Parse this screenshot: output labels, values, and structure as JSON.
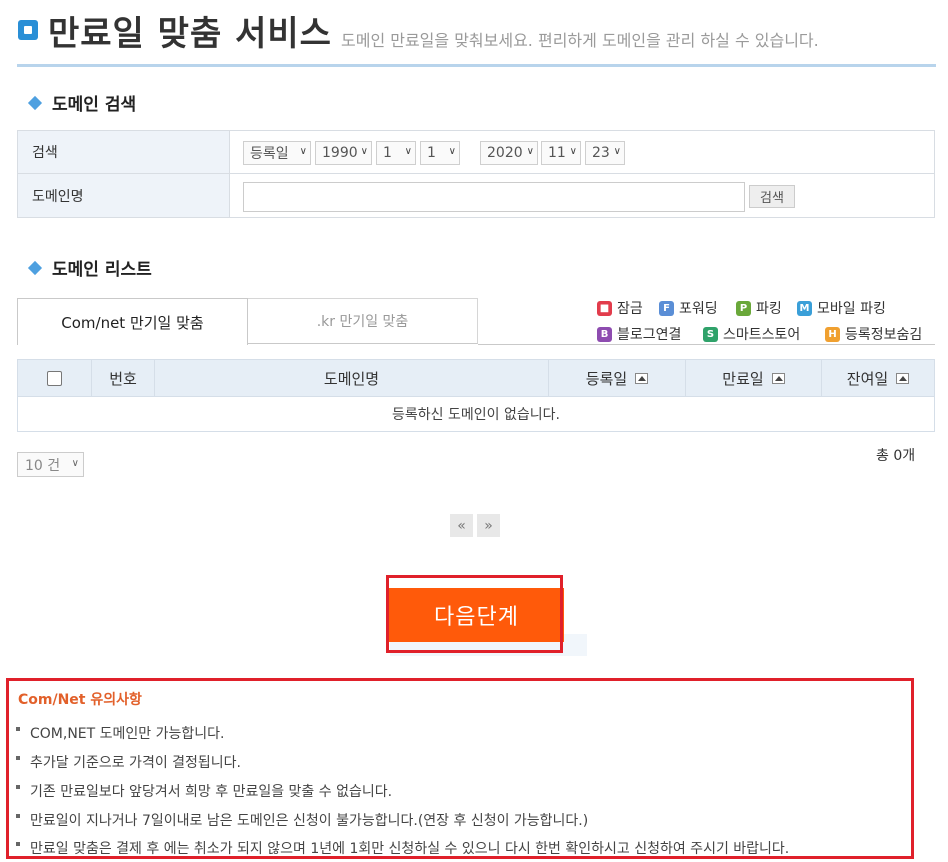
{
  "header": {
    "title": "만료일 맞춤 서비스",
    "subtitle": "도메인 만료일을 맞춰보세요. 편리하게 도메인을 관리 하실 수 있습니다."
  },
  "search_section": {
    "heading": "도메인 검색",
    "row_search_label": "검색",
    "date_type": "등록일",
    "from_year": "1990",
    "from_month": "1",
    "from_day": "1",
    "tilde": "~",
    "to_year": "2020",
    "to_month": "11",
    "to_day": "23",
    "row_domain_label": "도메인명",
    "domain_value": "",
    "search_button": "검색"
  },
  "list_section": {
    "heading": "도메인 리스트",
    "tabs": [
      {
        "label": "Com/net 만기일 맞춤",
        "active": true
      },
      {
        "label": ".kr 만기일 맞춤",
        "active": false
      }
    ],
    "legend": [
      {
        "icon": "lock-icon",
        "glyph": "🔒",
        "label": "잠금",
        "color": "#e23c4c"
      },
      {
        "icon": "forwarding-icon",
        "glyph": "F",
        "label": "포워딩",
        "color": "#5a8ed6"
      },
      {
        "icon": "parking-icon",
        "glyph": "P",
        "label": "파킹",
        "color": "#6aa83a"
      },
      {
        "icon": "mobile-parking-icon",
        "glyph": "M",
        "label": "모바일 파킹",
        "color": "#3a9fd8"
      },
      {
        "icon": "blog-link-icon",
        "glyph": "B",
        "label": "블로그연결",
        "color": "#8e4cb0"
      },
      {
        "icon": "smartstore-icon",
        "glyph": "S",
        "label": "스마트스토어",
        "color": "#2fa26a"
      },
      {
        "icon": "hide-registration-icon",
        "glyph": "H",
        "label": "등록정보숨김",
        "color": "#f0a030"
      }
    ],
    "columns": {
      "number": "번호",
      "domain": "도메인명",
      "registered": "등록일",
      "expiry": "만료일",
      "remaining": "잔여일"
    },
    "empty_message": "등록하신 도메인이 없습니다.",
    "page_size": "10 건",
    "total": "총 0개",
    "prev_icon": "«",
    "next_icon": "»"
  },
  "next_button": "다음단계",
  "notice": {
    "title": "Com/Net 유의사항",
    "items": [
      "COM,NET 도메인만 가능합니다.",
      "추가달 기준으로 가격이 결정됩니다.",
      "기존 만료일보다 앞당겨서 희망 후 만료일을 맞출 수 없습니다.",
      "만료일이 지나거나 7일이내로 남은 도메인은 신청이 불가능합니다.(연장 후 신청이 가능합니다.)",
      "만료일 맞춤은 결제 후 에는 취소가 되지 않으며 1년에 1회만 신청하실 수 있으니 다시 한번 확인하시고 신청하여 주시기 바랍니다."
    ]
  }
}
